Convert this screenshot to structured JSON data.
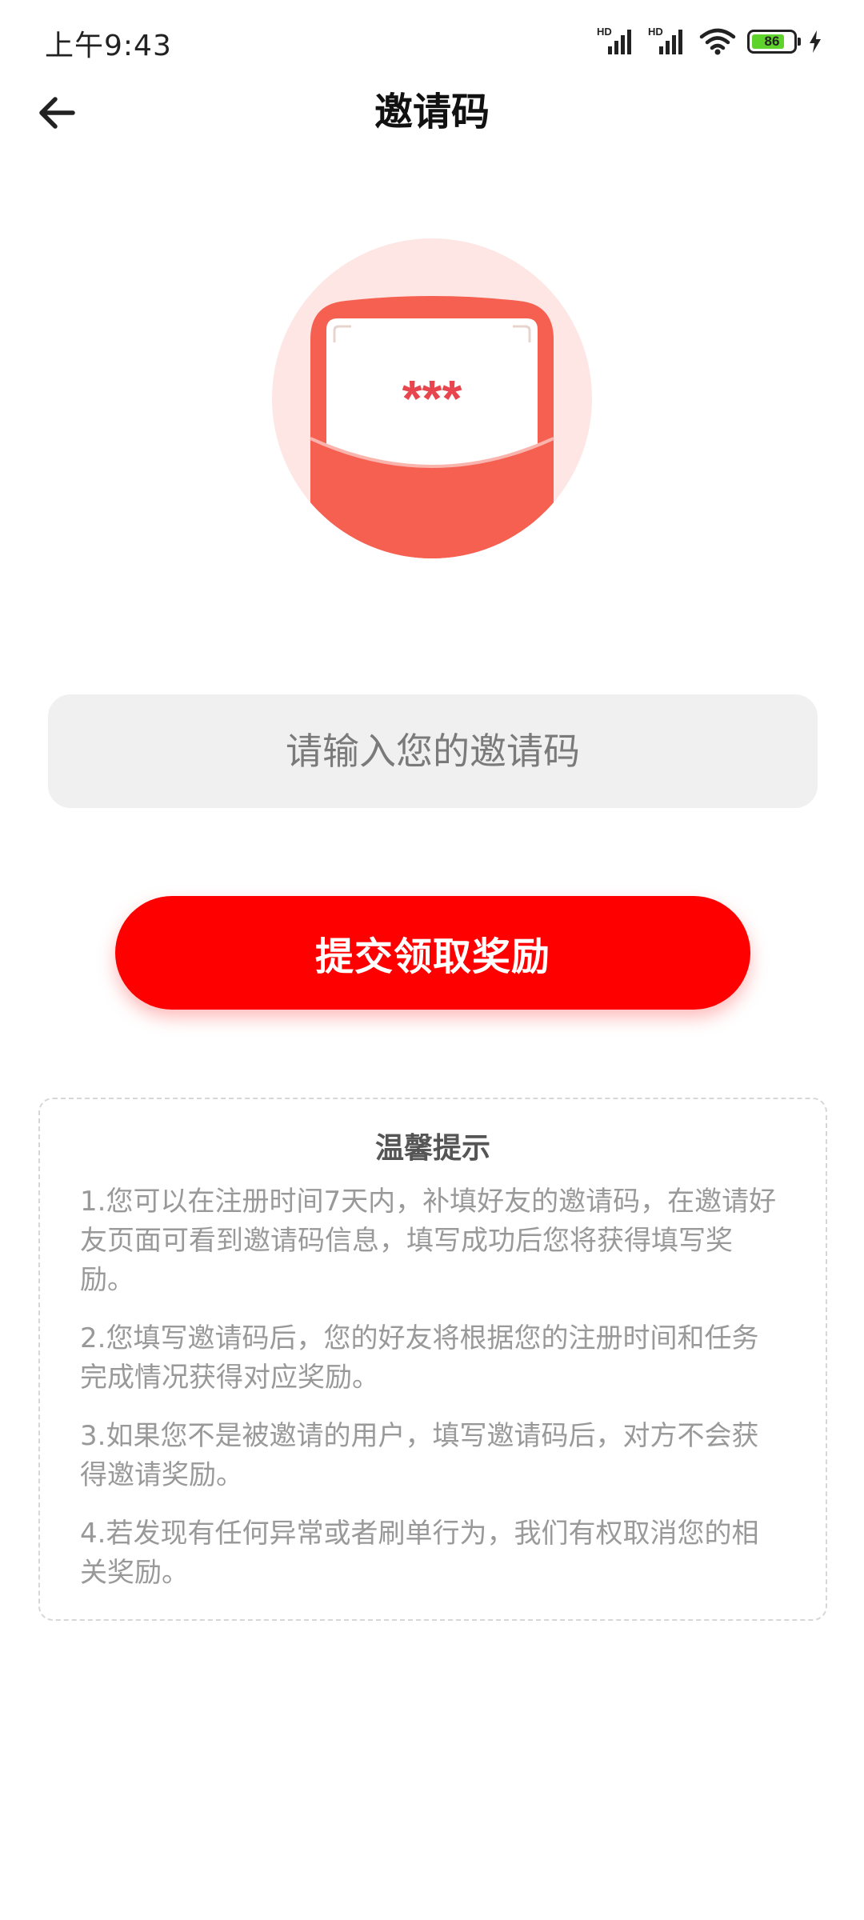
{
  "status_bar": {
    "time": "上午9:43",
    "signal_badge_1": "HD",
    "signal_badge_2": "HD",
    "battery_level": "86",
    "icons": [
      "signal-icon",
      "signal-icon",
      "wifi-icon",
      "battery-icon",
      "charging-icon"
    ]
  },
  "header": {
    "back_icon": "arrow-left-icon",
    "title": "邀请码"
  },
  "illustration": {
    "code_mask": "***"
  },
  "form": {
    "placeholder": "请输入您的邀请码",
    "value": "",
    "submit_label": "提交领取奖励"
  },
  "tips": {
    "title": "温馨提示",
    "items": [
      "1.您可以在注册时间7天内，补填好友的邀请码，在邀请好友页面可看到邀请码信息，填写成功后您将获得填写奖励。",
      "2.您填写邀请码后，您的好友将根据您的注册时间和任务完成情况获得对应奖励。",
      "3.如果您不是被邀请的用户，填写邀请码后，对方不会获得邀请奖励。",
      "4.若发现有任何异常或者刷单行为，我们有权取消您的相关奖励。"
    ]
  },
  "colors": {
    "accent": "#ff0000",
    "illustration_red": "#f56051",
    "illustration_bg": "#fde6e4",
    "input_bg": "#f0f0f0",
    "tip_text": "#999999"
  }
}
